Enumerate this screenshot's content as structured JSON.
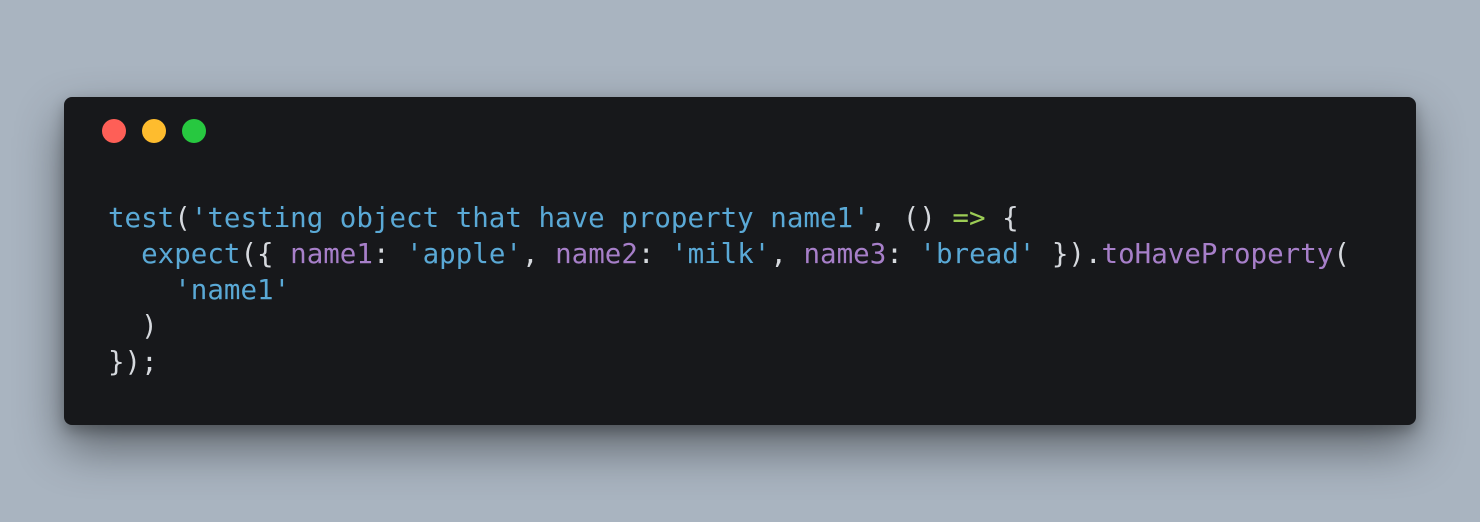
{
  "colors": {
    "background": "#a9b4c0",
    "window": "#17181b",
    "plain": "#d6d9de",
    "function": "#5aa9d6",
    "string": "#5aa9d6",
    "property": "#a77fc9",
    "method": "#a77fc9",
    "arrow": "#9ccc55",
    "close_dot": "#fe5f57",
    "minimize_dot": "#febc2e",
    "maximize_dot": "#27c840"
  },
  "window_controls": [
    {
      "name": "close-dot",
      "icon": "close-icon",
      "color": "#fe5f57"
    },
    {
      "name": "minimize-dot",
      "icon": "minimize-icon",
      "color": "#febc2e"
    },
    {
      "name": "maximize-dot",
      "icon": "maximize-icon",
      "color": "#27c840"
    }
  ],
  "code": {
    "language": "javascript",
    "lines": [
      [
        {
          "text": "test",
          "kind": "function"
        },
        {
          "text": "(",
          "kind": "plain"
        },
        {
          "text": "'testing object that have property name1'",
          "kind": "string"
        },
        {
          "text": ", () ",
          "kind": "plain"
        },
        {
          "text": "=>",
          "kind": "arrow"
        },
        {
          "text": " {",
          "kind": "plain"
        }
      ],
      [
        {
          "text": "  ",
          "kind": "plain"
        },
        {
          "text": "expect",
          "kind": "function"
        },
        {
          "text": "({ ",
          "kind": "plain"
        },
        {
          "text": "name1",
          "kind": "property"
        },
        {
          "text": ": ",
          "kind": "plain"
        },
        {
          "text": "'apple'",
          "kind": "string"
        },
        {
          "text": ", ",
          "kind": "plain"
        },
        {
          "text": "name2",
          "kind": "property"
        },
        {
          "text": ": ",
          "kind": "plain"
        },
        {
          "text": "'milk'",
          "kind": "string"
        },
        {
          "text": ", ",
          "kind": "plain"
        },
        {
          "text": "name3",
          "kind": "property"
        },
        {
          "text": ": ",
          "kind": "plain"
        },
        {
          "text": "'bread'",
          "kind": "string"
        },
        {
          "text": " }).",
          "kind": "plain"
        },
        {
          "text": "toHaveProperty",
          "kind": "method"
        },
        {
          "text": "(",
          "kind": "plain"
        }
      ],
      [
        {
          "text": "    ",
          "kind": "plain"
        },
        {
          "text": "'name1'",
          "kind": "string"
        }
      ],
      [
        {
          "text": "  )",
          "kind": "plain"
        }
      ],
      [
        {
          "text": "});",
          "kind": "plain"
        }
      ]
    ]
  }
}
